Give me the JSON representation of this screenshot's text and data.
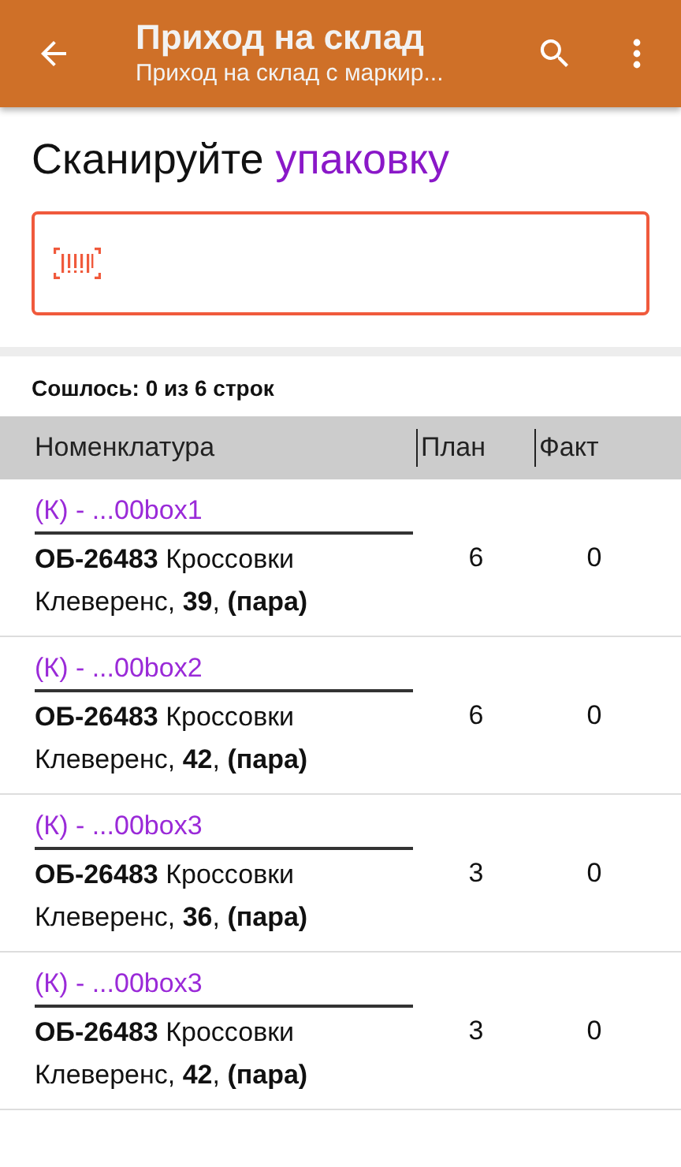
{
  "app_bar": {
    "title": "Приход на склад",
    "subtitle": "Приход на склад с маркир..."
  },
  "prompt": {
    "text": "Сканируйте",
    "highlight": "упаковку"
  },
  "scan_field": {
    "focused": true
  },
  "summary": "Сошлось: 0 из 6 строк",
  "table": {
    "columns": [
      "Номенклатура",
      "План",
      "Факт"
    ],
    "rows": [
      {
        "link": "(К) - ...00box1",
        "description": "**ОБ-26483** Кроссовки Клеверенс, **39**, **(пара)**",
        "plan": "6",
        "fact": "0"
      },
      {
        "link": "(К) - ...00box2",
        "description": "**ОБ-26483** Кроссовки Клеверенс, **42**, **(пара)**",
        "plan": "6",
        "fact": "0"
      },
      {
        "link": "(К) - ...00box3",
        "description": "**ОБ-26483** Кроссовки Клеверенс, **36**, **(пара)**",
        "plan": "3",
        "fact": "0"
      },
      {
        "link": "(К) - ...00box3",
        "description": "**ОБ-26483** Кроссовки Клеверенс, **42**, **(пара)**",
        "plan": "3",
        "fact": "0"
      }
    ]
  }
}
